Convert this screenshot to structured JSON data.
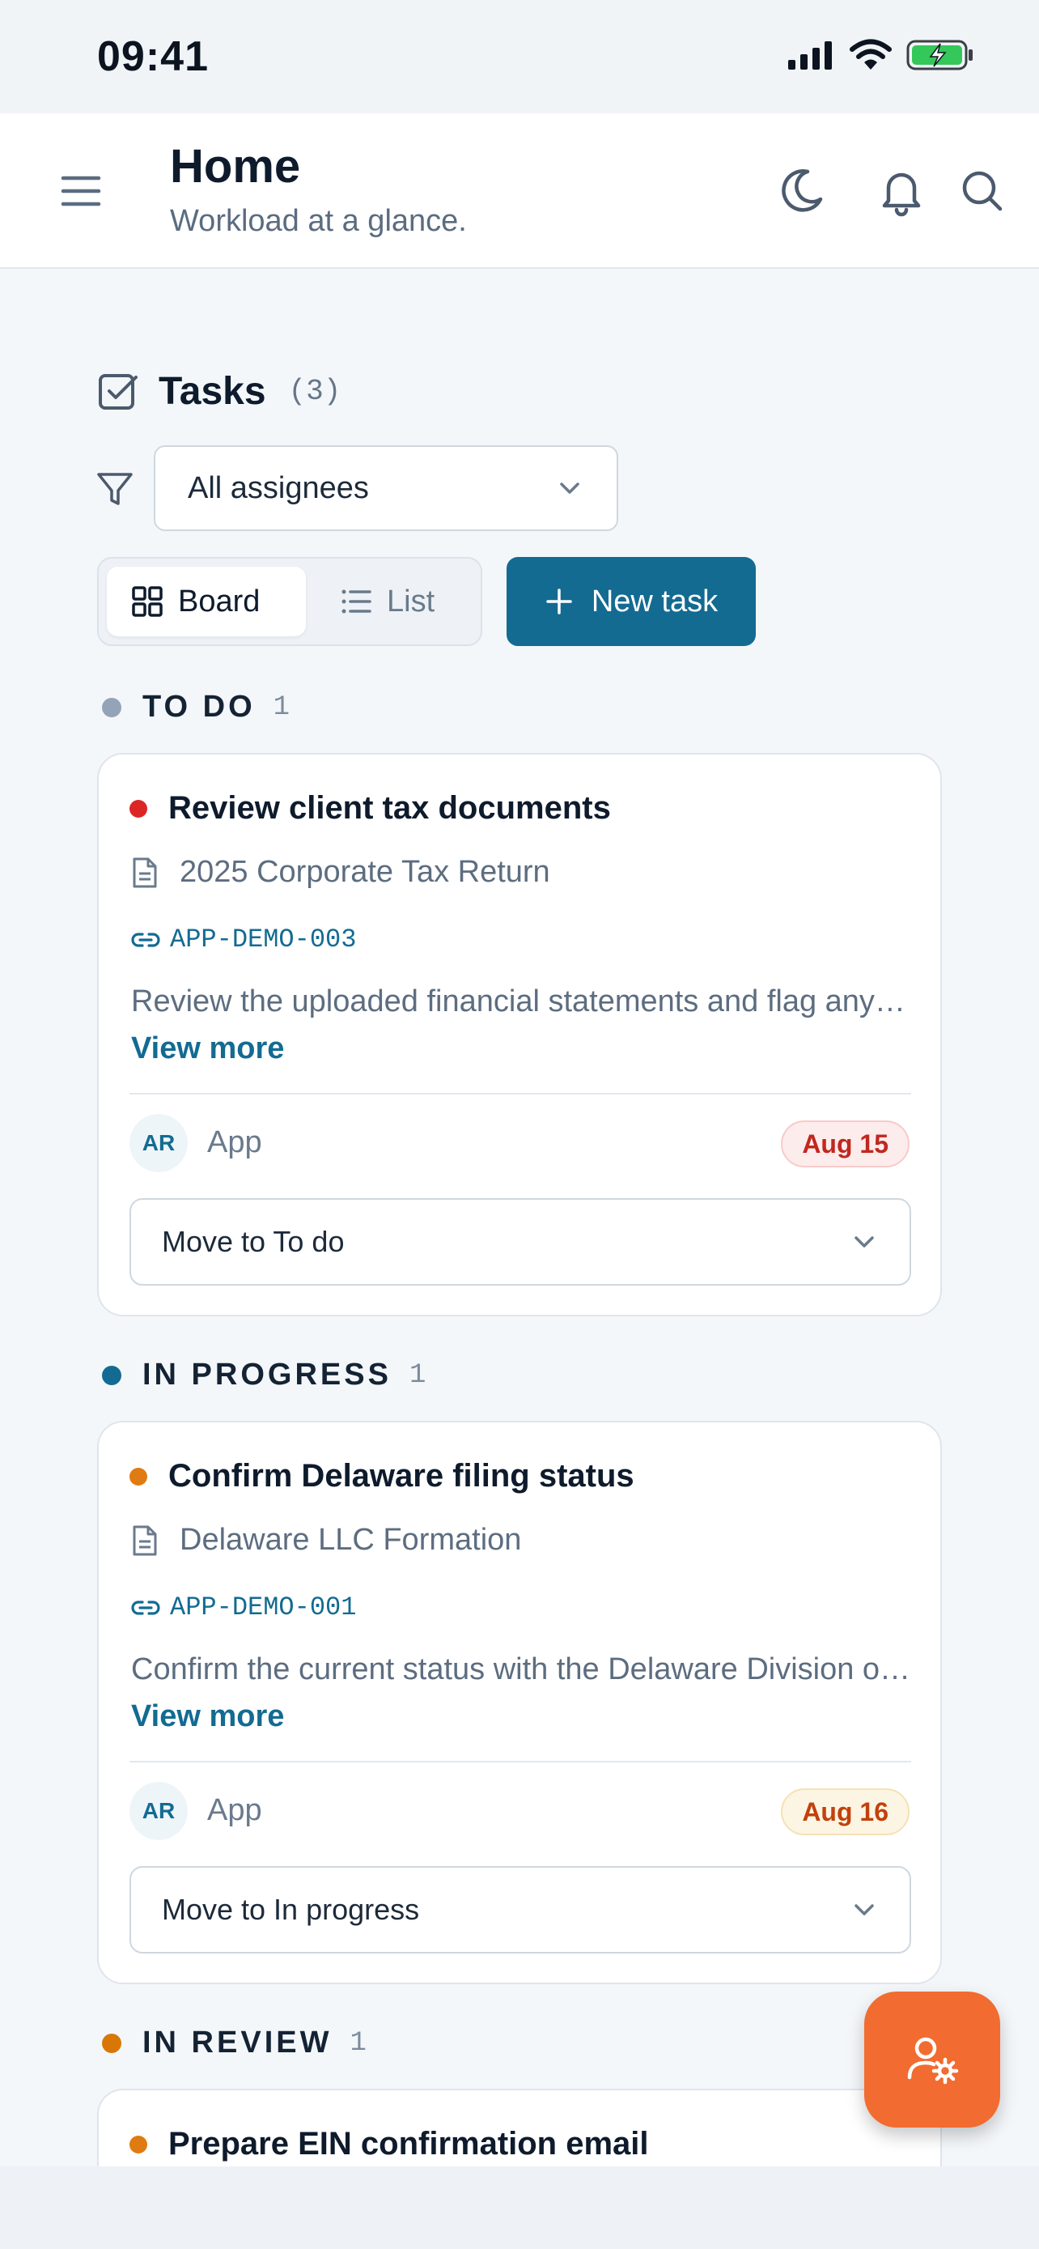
{
  "status_bar": {
    "time": "09:41"
  },
  "header": {
    "title": "Home",
    "subtitle": "Workload at a glance."
  },
  "section": {
    "title": "Tasks",
    "count": "(3)"
  },
  "filter": {
    "assignee_value": "All assignees"
  },
  "view_toggle": {
    "board_label": "Board",
    "list_label": "List",
    "active": "Board"
  },
  "new_task_label": "New task",
  "colors": {
    "accent": "#136b92",
    "fab": "#f26b30",
    "high_priority": "#dc2626",
    "medium_priority": "#e07b12"
  },
  "columns": [
    {
      "label": "TO DO",
      "count": "1",
      "dot_color": "#94a3b8",
      "card": {
        "title": "Review client tax documents",
        "priority_color": "#dc2626",
        "project": "2025 Corporate Tax Return",
        "ref": "APP-DEMO-003",
        "description": "Review the uploaded financial statements and flag any missing documents before filing.",
        "view_more": "View more",
        "avatar": "AR",
        "assignee": "App",
        "due": "Aug 15",
        "due_bg": "#fdecec",
        "due_border": "#f8caca",
        "due_color": "#c0281f",
        "move_label": "Move to To do"
      }
    },
    {
      "label": "IN PROGRESS",
      "count": "1",
      "dot_color": "#136b92",
      "card": {
        "title": "Confirm Delaware filing status",
        "priority_color": "#e07b12",
        "project": "Delaware LLC Formation",
        "ref": "APP-DEMO-001",
        "description": "Confirm the current status with the Delaware Division of Corporations.",
        "view_more": "View more",
        "avatar": "AR",
        "assignee": "App",
        "due": "Aug 16",
        "due_bg": "#fdf5e3",
        "due_border": "#f4e2b4",
        "due_color": "#c2410c",
        "move_label": "Move to In progress"
      }
    },
    {
      "label": "IN REVIEW",
      "count": "1",
      "dot_color": "#d97706",
      "card": {
        "title": "Prepare EIN confirmation email",
        "priority_color": "#e07b12"
      }
    }
  ]
}
